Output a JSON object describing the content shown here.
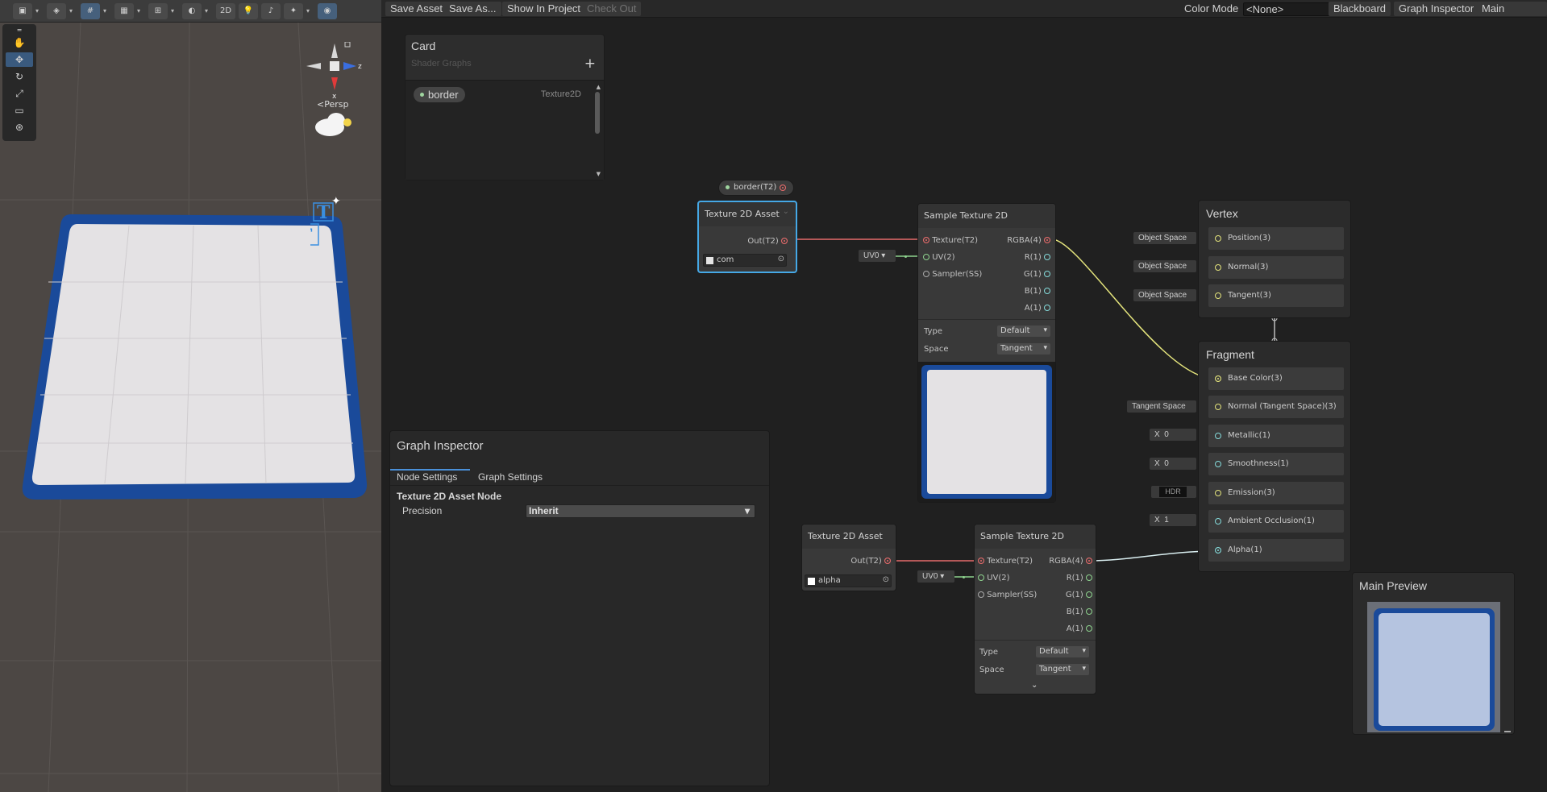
{
  "scene": {
    "toolbar_2d": "2D",
    "persp_label": "<Persp",
    "axis_z": "z",
    "axis_x": "x"
  },
  "topbar": {
    "save_asset": "Save Asset",
    "save_as": "Save As...",
    "show_in_project": "Show In Project",
    "check_out": "Check Out",
    "color_mode_label": "Color Mode",
    "color_mode_value": "<None>",
    "blackboard": "Blackboard",
    "graph_inspector": "Graph Inspector",
    "main_preview": "Main Preview"
  },
  "blackboard": {
    "title": "Card",
    "subtitle": "Shader Graphs",
    "add": "+",
    "property_name": "border",
    "property_type": "Texture2D"
  },
  "property_node": {
    "label": "border(T2)"
  },
  "texture_asset_1": {
    "title": "Texture 2D Asset",
    "out": "Out(T2)",
    "field": "com"
  },
  "sample_1": {
    "title": "Sample Texture 2D",
    "in_texture": "Texture(T2)",
    "in_uv": "UV(2)",
    "in_sampler": "Sampler(SS)",
    "out_rgba": "RGBA(4)",
    "out_r": "R(1)",
    "out_g": "G(1)",
    "out_b": "B(1)",
    "out_a": "A(1)",
    "type_label": "Type",
    "type_value": "Default",
    "space_label": "Space",
    "space_value": "Tangent",
    "uv_chip": "UV0"
  },
  "texture_asset_2": {
    "title": "Texture 2D Asset",
    "out": "Out(T2)",
    "field": "alpha"
  },
  "sample_2": {
    "title": "Sample Texture 2D",
    "in_texture": "Texture(T2)",
    "in_uv": "UV(2)",
    "in_sampler": "Sampler(SS)",
    "out_rgba": "RGBA(4)",
    "out_r": "R(1)",
    "out_g": "G(1)",
    "out_b": "B(1)",
    "out_a": "A(1)",
    "type_label": "Type",
    "type_value": "Default",
    "space_label": "Space",
    "space_value": "Tangent",
    "uv_chip": "UV0"
  },
  "vertex": {
    "title": "Vertex",
    "blocks": [
      {
        "label": "Position(3)",
        "chip": "Object Space"
      },
      {
        "label": "Normal(3)",
        "chip": "Object Space"
      },
      {
        "label": "Tangent(3)",
        "chip": "Object Space"
      }
    ]
  },
  "fragment": {
    "title": "Fragment",
    "blocks": [
      {
        "label": "Base Color(3)",
        "chip": ""
      },
      {
        "label": "Normal (Tangent Space)(3)",
        "chip": "Tangent Space"
      },
      {
        "label": "Metallic(1)",
        "chip_x": "X",
        "chip_val": "0"
      },
      {
        "label": "Smoothness(1)",
        "chip_x": "X",
        "chip_val": "0"
      },
      {
        "label": "Emission(3)",
        "chip": "HDR"
      },
      {
        "label": "Ambient Occlusion(1)",
        "chip_x": "X",
        "chip_val": "1"
      },
      {
        "label": "Alpha(1)",
        "chip": ""
      }
    ]
  },
  "inspector": {
    "title": "Graph Inspector",
    "tab_node": "Node Settings",
    "tab_graph": "Graph Settings",
    "node_title": "Texture 2D Asset Node",
    "precision_label": "Precision",
    "precision_value": "Inherit"
  },
  "main_preview": {
    "title": "Main Preview"
  },
  "colors": {
    "accent": "#45a8e6",
    "card_blue": "#1a4a9a",
    "card_face": "#e4e2e4",
    "edge_red": "#e66b6b",
    "edge_yellow": "#e4e47c"
  }
}
